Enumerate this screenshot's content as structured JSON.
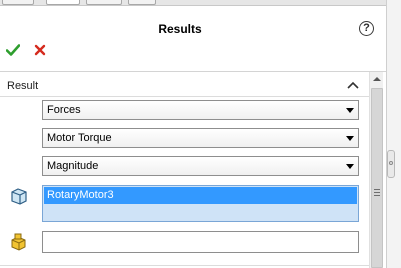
{
  "header": {
    "title": "Results",
    "help_glyph": "?"
  },
  "actions": {
    "ok_icon": "checkmark-icon",
    "cancel_icon": "x-icon",
    "ok_color": "#2e9e2e",
    "cancel_color": "#d52b1e"
  },
  "result": {
    "group_title": "Result",
    "result_type": "Forces",
    "component": "Motor Torque",
    "quantity": "Magnitude",
    "motor_selection": [
      "RotaryMotor3"
    ],
    "reference_value": ""
  },
  "colors": {
    "selection": "#3399ff",
    "listbox_bg": "#cfe3f7"
  }
}
